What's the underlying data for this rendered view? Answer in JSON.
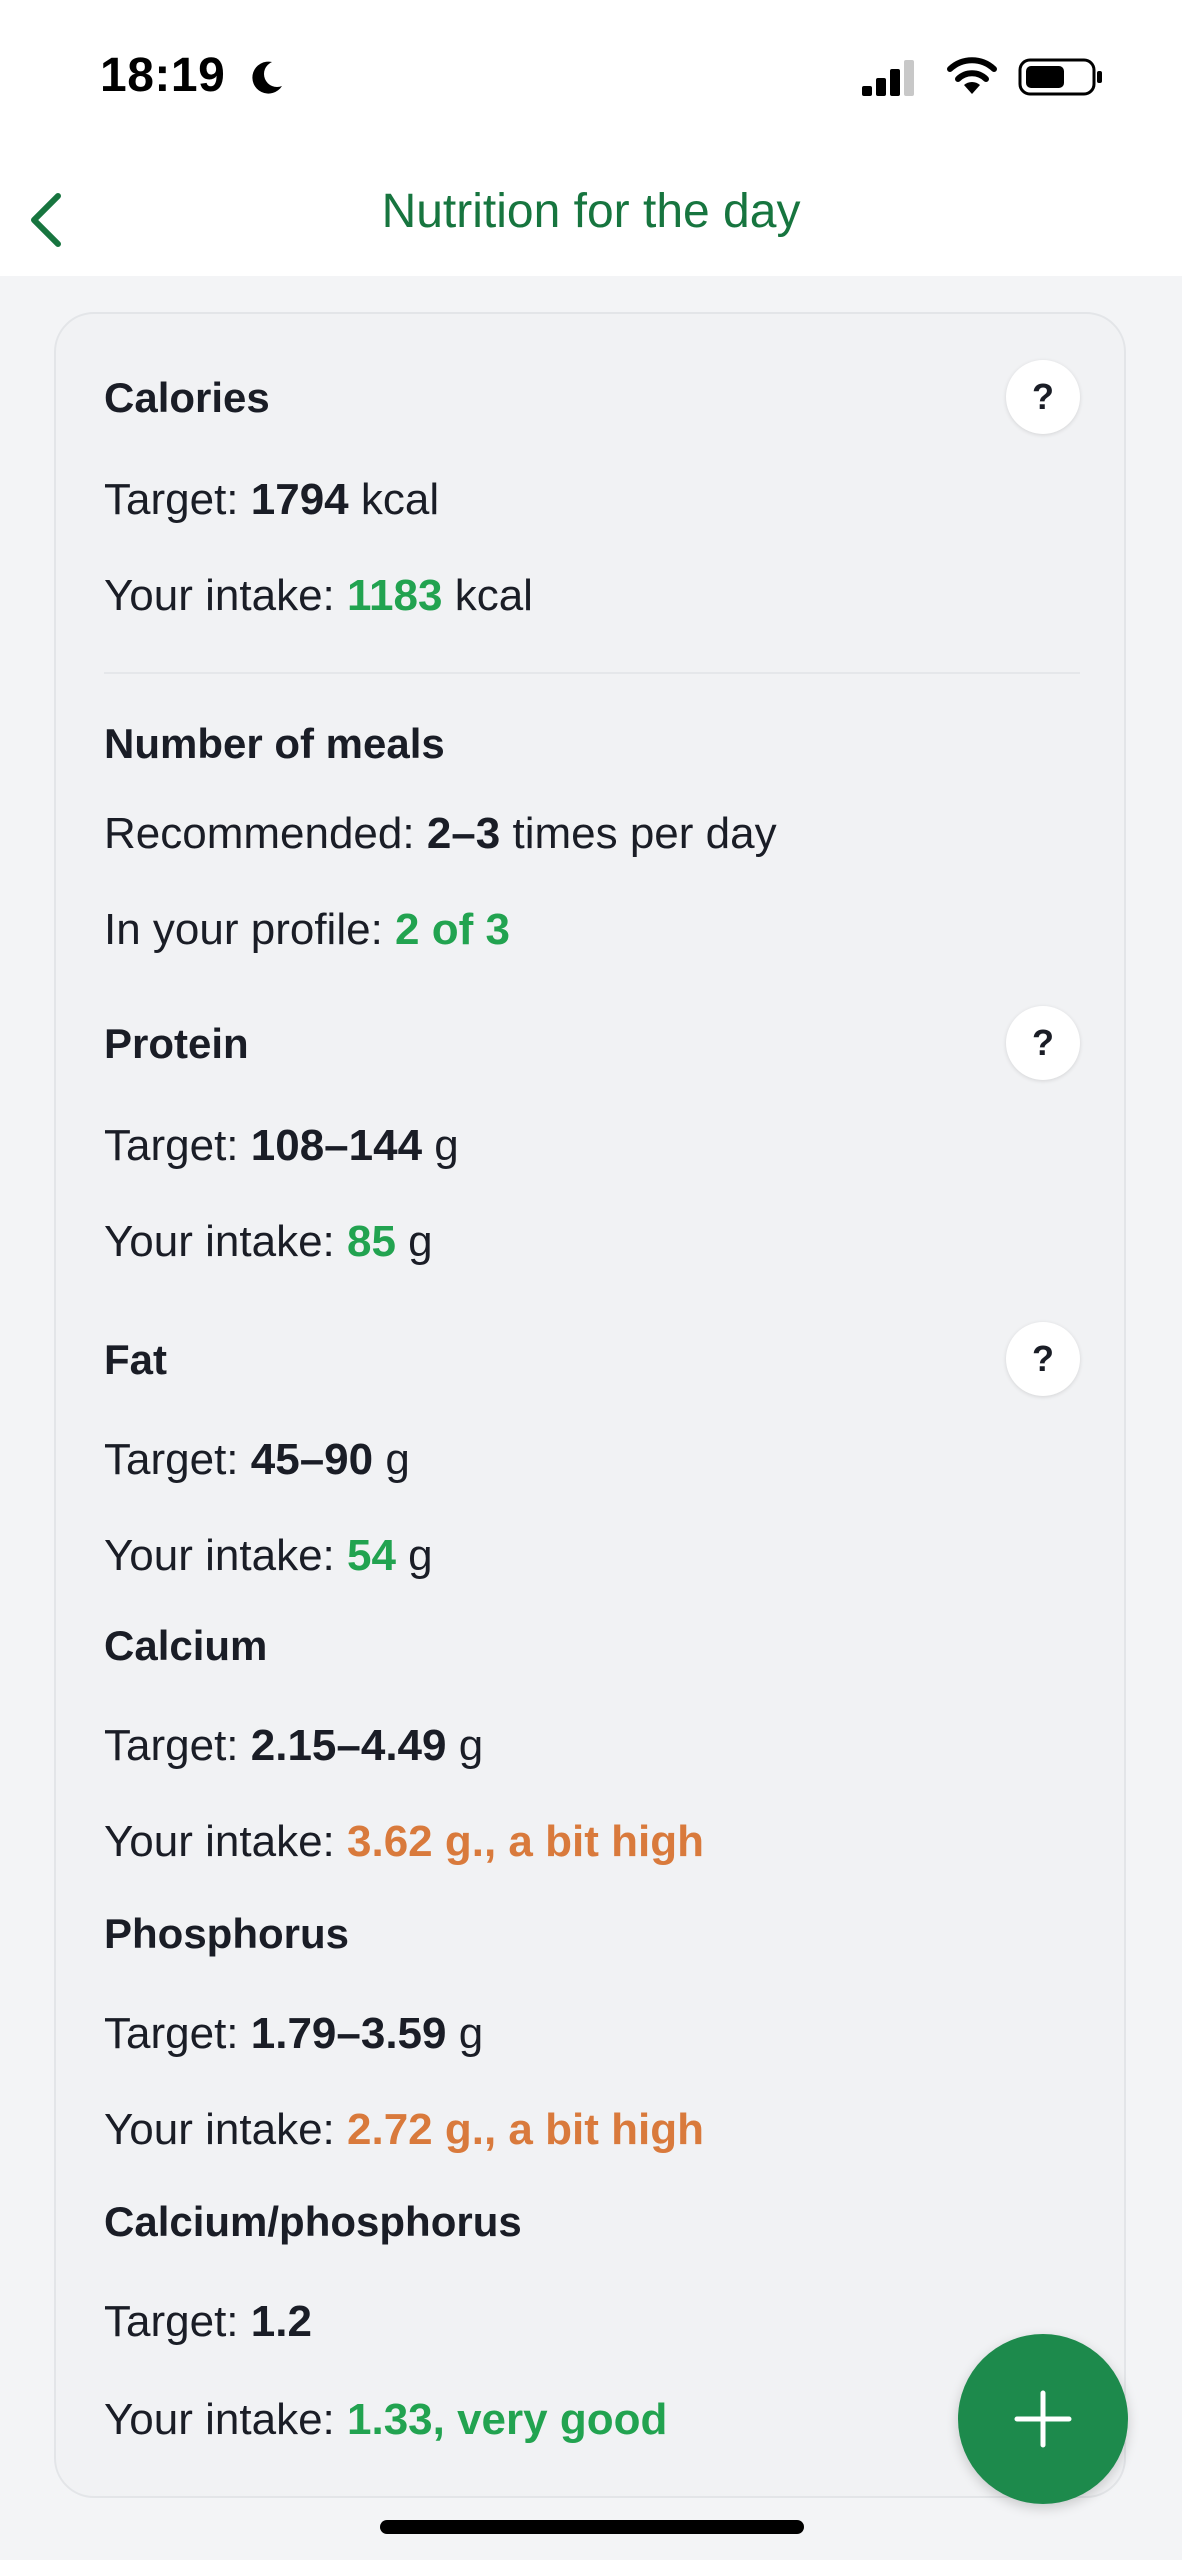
{
  "status_bar": {
    "time": "18:19"
  },
  "header": {
    "title": "Nutrition for the day",
    "accent_color": "#17753f"
  },
  "calories": {
    "title": "Calories",
    "target_label": "Target: ",
    "target_value": "1794",
    "target_unit": " kcal",
    "intake_label": "Your intake: ",
    "intake_value": "1183",
    "intake_unit": " kcal"
  },
  "meals": {
    "title": "Number of meals",
    "recommended_label": "Recommended: ",
    "recommended_value": "2–3",
    "recommended_unit": " times per day",
    "profile_label": "In your profile: ",
    "profile_value": "2 of 3"
  },
  "protein": {
    "title": "Protein",
    "target_label": "Target: ",
    "target_value": "108–144",
    "target_unit": " g",
    "intake_label": "Your intake: ",
    "intake_value": "85",
    "intake_unit": " g"
  },
  "fat": {
    "title": "Fat",
    "target_label": "Target: ",
    "target_value": "45–90",
    "target_unit": " g",
    "intake_label": "Your intake: ",
    "intake_value": "54",
    "intake_unit": " g"
  },
  "calcium": {
    "title": "Calcium",
    "target_label": "Target: ",
    "target_value": "2.15–4.49",
    "target_unit": " g",
    "intake_label": "Your intake: ",
    "intake_value": "3.62 g., a bit high"
  },
  "phosphorus": {
    "title": "Phosphorus",
    "target_label": "Target: ",
    "target_value": "1.79–3.59",
    "target_unit": " g",
    "intake_label": "Your intake: ",
    "intake_value": "2.72 g., a bit high"
  },
  "ratio": {
    "title": "Calcium/phosphorus",
    "target_label": "Target: ",
    "target_value": "1.2",
    "intake_label": "Your intake: ",
    "intake_value": "1.33, very good"
  },
  "help_label": "?",
  "icons": {
    "moon": "moon-icon",
    "signal": "signal-icon",
    "wifi": "wifi-icon",
    "battery": "battery-icon",
    "back": "chevron-left-icon",
    "add": "plus-icon"
  },
  "colors": {
    "good": "#22a350",
    "warning": "#d97a3c",
    "fab": "#1d8a4c"
  }
}
